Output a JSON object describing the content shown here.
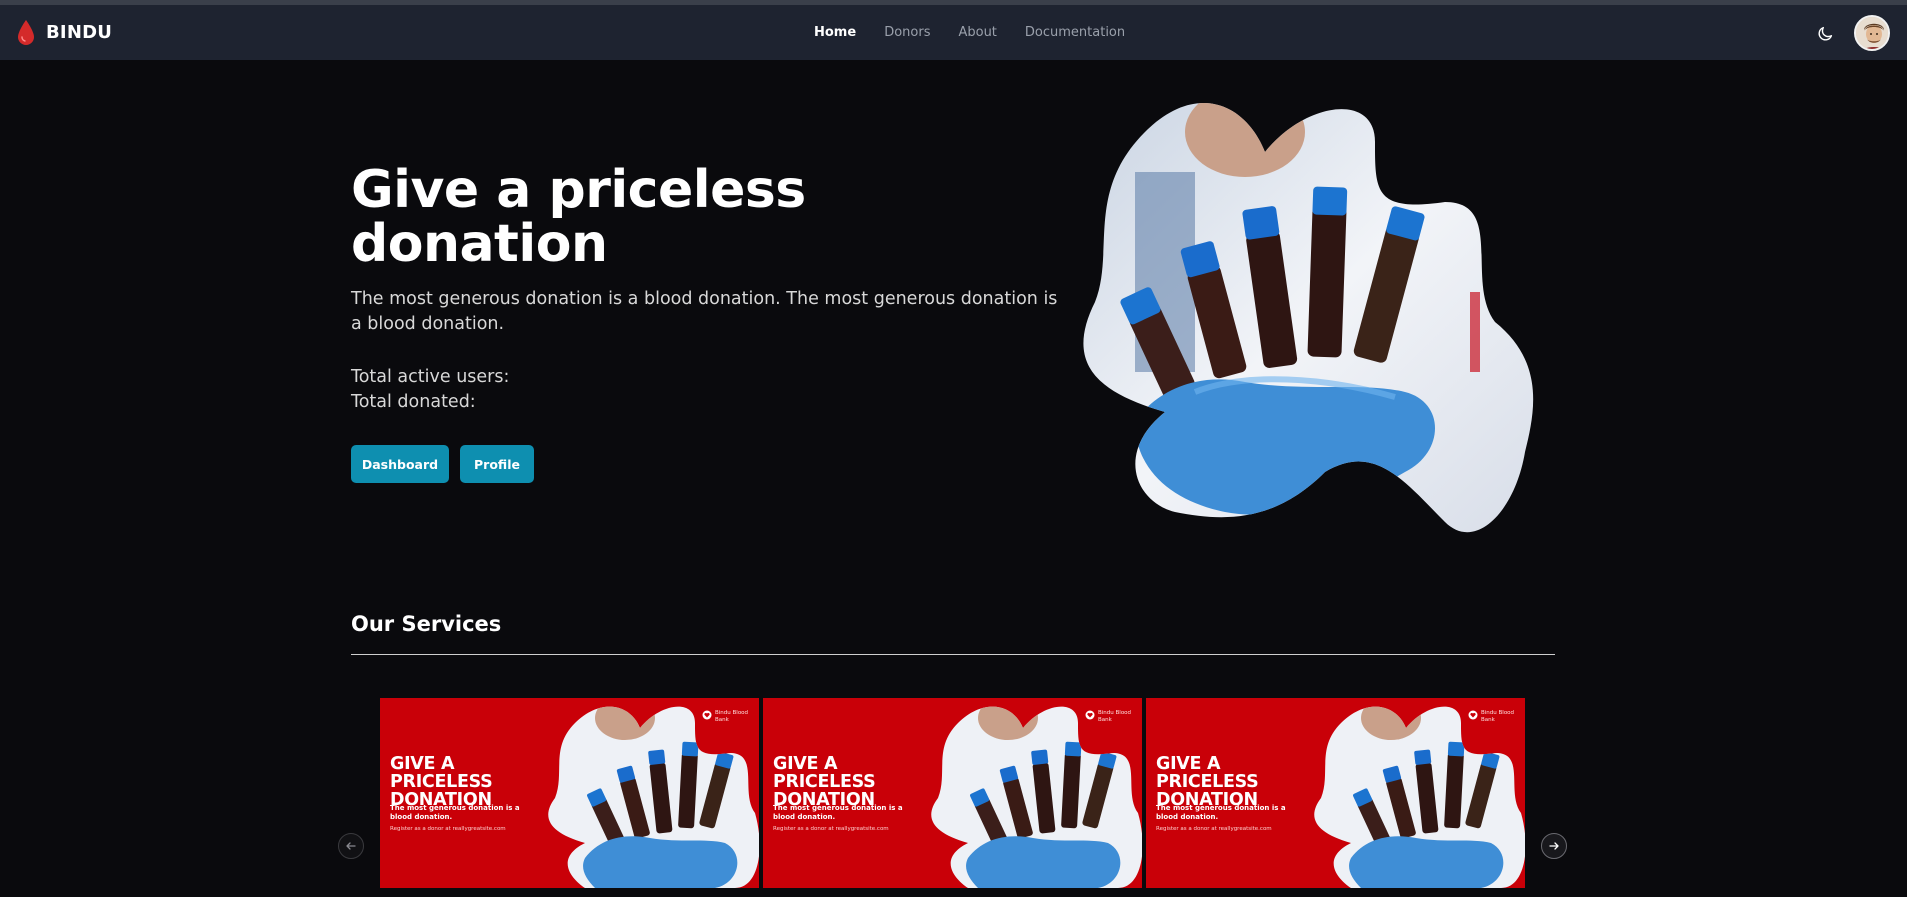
{
  "navbar": {
    "brand": "BINDU",
    "links": [
      {
        "label": "Home",
        "active": true
      },
      {
        "label": "Donors",
        "active": false
      },
      {
        "label": "About",
        "active": false
      },
      {
        "label": "Documentation",
        "active": false
      }
    ],
    "theme_icon": "moon-icon",
    "avatar_icon": "user-avatar"
  },
  "hero": {
    "title": "Give a priceless donation",
    "description": "The most generous donation is a blood donation. The most generous donation is a blood donation.",
    "stats": {
      "active_users_label": "Total active users:",
      "donated_label": "Total donated:"
    },
    "buttons": {
      "dashboard": "Dashboard",
      "profile": "Profile"
    }
  },
  "services": {
    "title": "Our Services",
    "cards": [
      {
        "heading": "GIVE A PRICELESS DONATION",
        "sub": "The most generous donation is a blood donation.",
        "note": "Register as a donor at reallygreatsite.com",
        "brand": "Bindu Blood Bank"
      },
      {
        "heading": "GIVE A PRICELESS DONATION",
        "sub": "The most generous donation is a blood donation.",
        "note": "Register as a donor at reallygreatsite.com",
        "brand": "Bindu Blood Bank"
      },
      {
        "heading": "GIVE A PRICELESS DONATION",
        "sub": "The most generous donation is a blood donation.",
        "note": "Register as a donor at reallygreatsite.com",
        "brand": "Bindu Blood Bank"
      }
    ],
    "prev_icon": "arrow-left-icon",
    "next_icon": "arrow-right-icon"
  },
  "colors": {
    "background": "#0a0a0d",
    "navbar": "#1e2330",
    "accent_button": "#0e8fb0",
    "brand_red": "#c90008",
    "drop_red": "#d42a2a"
  }
}
